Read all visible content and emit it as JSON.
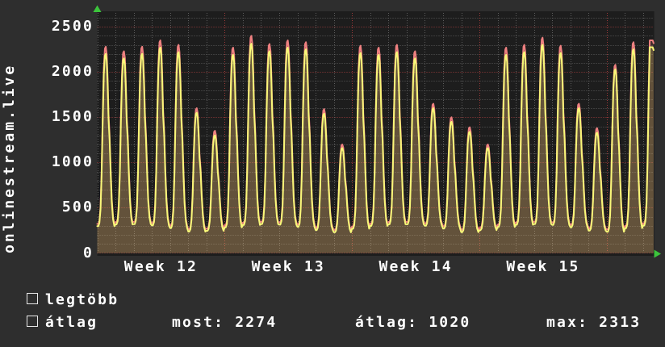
{
  "page": {
    "background": "#2e2e2e",
    "plot_background": "#1d1d1d",
    "text_color": "#ffffff",
    "grid_minor_color": "#5d5d5d",
    "grid_major_color": "#9e3a3a",
    "arrow_color": "#3cc43c"
  },
  "ylabel": "onlinestream.live",
  "legend": {
    "items": [
      {
        "label": "legtöbb",
        "color": "#ee8080"
      },
      {
        "label": "átlag",
        "color": "#f8f878"
      }
    ]
  },
  "stats": [
    {
      "name": "most",
      "text": "most: 2274",
      "value": 2274
    },
    {
      "name": "atlag",
      "text": "átlag: 1020",
      "value": 1020
    },
    {
      "name": "max",
      "text": "max: 2313",
      "value": 2313
    }
  ],
  "chart_data": {
    "type": "line",
    "title": "",
    "ylabel": "onlinestream.live",
    "xlabel": "",
    "grid": true,
    "legend_position": "bottom-left",
    "x_axis": {
      "unit": "day",
      "days_total": 30.6,
      "week_boundaries_days": [
        7,
        14,
        21,
        28
      ],
      "tick_labels": [
        "Week 12",
        "Week 13",
        "Week 14",
        "Week 15"
      ],
      "tick_label_centers_days": [
        3.5,
        10.5,
        17.5,
        24.5
      ]
    },
    "y_axis": {
      "ticks": [
        0,
        500,
        1000,
        1500,
        2000,
        2500
      ],
      "minor_step": 100,
      "ylim": [
        0,
        2660
      ]
    },
    "series": [
      {
        "name": "legtöbb",
        "color": "#ee8080",
        "fill_opacity": 0.18,
        "day_peaks": [
          2280,
          2230,
          2280,
          2350,
          2300,
          1600,
          1350,
          2270,
          2400,
          2310,
          2350,
          2330,
          1590,
          1200,
          2290,
          2270,
          2300,
          2230,
          1650,
          1500,
          1390,
          1200,
          2270,
          2300,
          2380,
          2290,
          1650,
          1380,
          2080,
          2330,
          2350
        ]
      },
      {
        "name": "átlag",
        "color": "#f8f878",
        "fill_opacity": 0.18,
        "day_peaks": [
          2200,
          2150,
          2200,
          2270,
          2220,
          1550,
          1300,
          2190,
          2313,
          2230,
          2270,
          2250,
          1540,
          1160,
          2210,
          2190,
          2220,
          2150,
          1600,
          1450,
          1340,
          1160,
          2190,
          2220,
          2300,
          2210,
          1600,
          1330,
          2030,
          2250,
          2274
        ]
      }
    ],
    "stats": {
      "most": 2274,
      "atlag": 1020,
      "max": 2313
    }
  }
}
